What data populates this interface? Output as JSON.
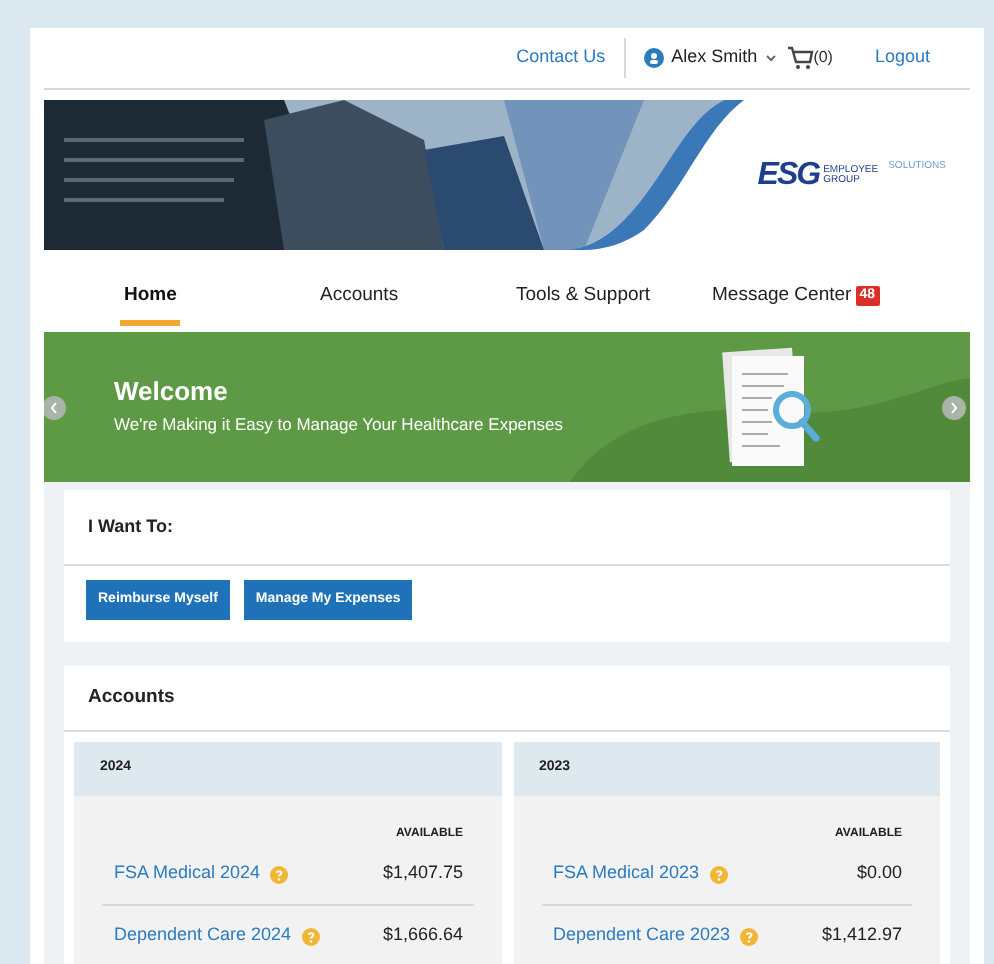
{
  "header": {
    "contact_link": "Contact Us",
    "user_name": "Alex Smith",
    "cart_count": "(0)",
    "logout_link": "Logout"
  },
  "logo": {
    "mark": "ESG",
    "line_1": "EMPLOYEE",
    "line_2": "GROUP",
    "tagline": "SOLUTIONS"
  },
  "nav": [
    {
      "label": "Home",
      "selected": true
    },
    {
      "label": "Accounts",
      "selected": false
    },
    {
      "label": "Tools & Support",
      "selected": false
    },
    {
      "label": "Message Center",
      "selected": false,
      "badge": "48"
    }
  ],
  "hero": {
    "title": "Welcome",
    "subtitle": "We're Making it Easy to Manage Your Healthcare Expenses"
  },
  "i_want_to": {
    "title": "I Want To:",
    "buttons": [
      "Reimburse Myself",
      "Manage My Expenses"
    ]
  },
  "accounts": {
    "title": "Accounts",
    "panels": [
      {
        "year": "2024",
        "column_header": "AVAILABLE",
        "rows": [
          {
            "name": "FSA Medical 2024",
            "amount": "$1,407.75"
          },
          {
            "name": "Dependent Care 2024",
            "amount": "$1,666.64"
          }
        ]
      },
      {
        "year": "2023",
        "column_header": "AVAILABLE",
        "rows": [
          {
            "name": "FSA Medical 2023",
            "amount": "$0.00"
          },
          {
            "name": "Dependent Care 2023",
            "amount": "$1,412.97"
          }
        ]
      }
    ]
  }
}
